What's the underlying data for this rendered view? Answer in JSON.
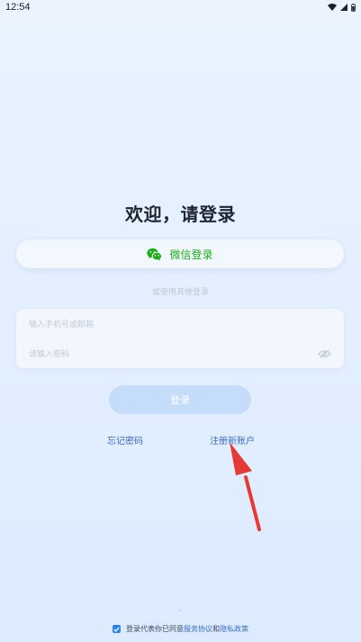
{
  "status_bar": {
    "time": "12:54",
    "icons": [
      "wifi-icon",
      "cellular-icon",
      "battery-icon"
    ]
  },
  "title": "欢迎，请登录",
  "wechat_login": {
    "label": "微信登录",
    "icon": "wechat-icon",
    "color": "#1aad19"
  },
  "other_login_hint": "或使用其他登录",
  "form": {
    "phone_placeholder": "输入手机号或邮箱",
    "password_placeholder": "请输入密码",
    "toggle_icon": "eye-off-icon"
  },
  "login_button": "登录",
  "links": {
    "forgot": "忘记密码",
    "register": "注册新账户"
  },
  "agreement": {
    "checked": true,
    "prefix": "登录代表你已同意",
    "terms": "服务协议",
    "and": "和",
    "privacy": "隐私政策"
  },
  "colors": {
    "accent": "#3a6fc6",
    "login_button": "#c5ddfb",
    "annotation_arrow": "#e53935"
  }
}
